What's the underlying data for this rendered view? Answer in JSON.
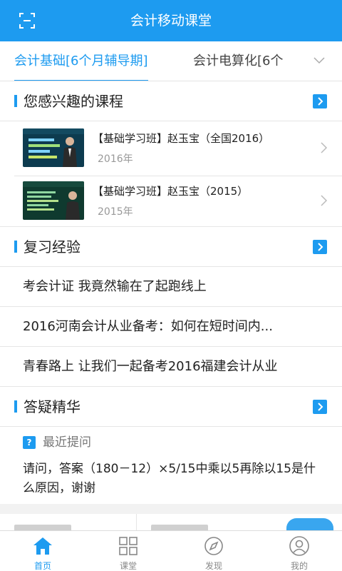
{
  "header": {
    "title": "会计移动课堂",
    "scan_icon": "scan-icon"
  },
  "tabs": {
    "active": "会计基础[6个月辅导期]",
    "second": "会计电算化[6个",
    "dropdown_icon": "chevron-down-icon"
  },
  "interest": {
    "heading": "您感兴趣的课程",
    "courses": [
      {
        "title": "【基础学习班】赵玉宝（全国2016）",
        "year": "2016年"
      },
      {
        "title": "【基础学习班】赵玉宝（2015）",
        "year": "2015年"
      }
    ]
  },
  "review": {
    "heading": "复习经验",
    "articles": [
      "考会计证 我竟然输在了起跑线上",
      "2016河南会计从业备考：如何在短时间内...",
      "青春路上 让我们一起备考2016福建会计从业"
    ]
  },
  "qa": {
    "heading": "答疑精华",
    "recent_label": "最近提问",
    "question": "请问，答案（180－12）×5/15中乘以5再除以15是什么原因，谢谢"
  },
  "tabbar": [
    {
      "label": "首页",
      "icon": "home-icon",
      "active": true
    },
    {
      "label": "课堂",
      "icon": "grid-icon",
      "active": false
    },
    {
      "label": "发现",
      "icon": "compass-icon",
      "active": false
    },
    {
      "label": "我的",
      "icon": "user-icon",
      "active": false
    }
  ],
  "colors": {
    "accent": "#1d9bf0",
    "text": "#222222",
    "muted": "#999999"
  }
}
